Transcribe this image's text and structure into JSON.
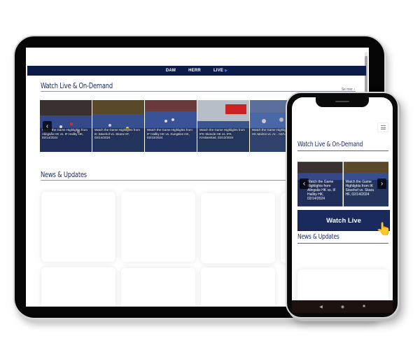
{
  "nav": {
    "items": [
      "DAM",
      "HERR",
      "LIVE"
    ],
    "live_indicator": "▶"
  },
  "colors": {
    "navy": "#0c1c4a",
    "heading": "#1b2a5c",
    "accent_arrow": "#3b7bff"
  },
  "watch_section": {
    "title": "Watch Live & On-Demand",
    "see_more": "Se mer ›",
    "prev_icon": "‹",
    "next_icon": "›",
    "slides": [
      {
        "caption": "Watch the Game Highlights from Alingsås HK vs. IF Hallby HK, 02/14/2024"
      },
      {
        "caption": "Watch the Game Highlights from IK Sävehof vs. Skara HF, 02/14/2024"
      },
      {
        "caption": "Watch the Game Highlights from IF Hallby HK vs. Kungälvs HK, 02/10/2024"
      },
      {
        "caption": "Watch the Game Highlights from IFK Skövde HK vs. IFK Kristianstad, 02/13/2024"
      },
      {
        "caption": "Watch the Game Highlights from HK Malmö vs. Ar... 02/13/2024"
      }
    ]
  },
  "news_section": {
    "title": "News & Updates"
  },
  "phone": {
    "watch_title": "Watch Live & On-Demand",
    "slides": [
      {
        "caption": "Watch the Game Highlights from Alingsås HK vs. IF Hallby HK, 02/14/2024"
      },
      {
        "caption": "Watch the Game Highlights from IK Sävehof vs. Skara HF, 02/14/2024"
      }
    ],
    "watch_live_button": "Watch Live",
    "news_title": "News & Updates",
    "android_nav": {
      "back": "◀",
      "home": "◉",
      "recent": "■"
    },
    "cursor_icon": "👆"
  }
}
